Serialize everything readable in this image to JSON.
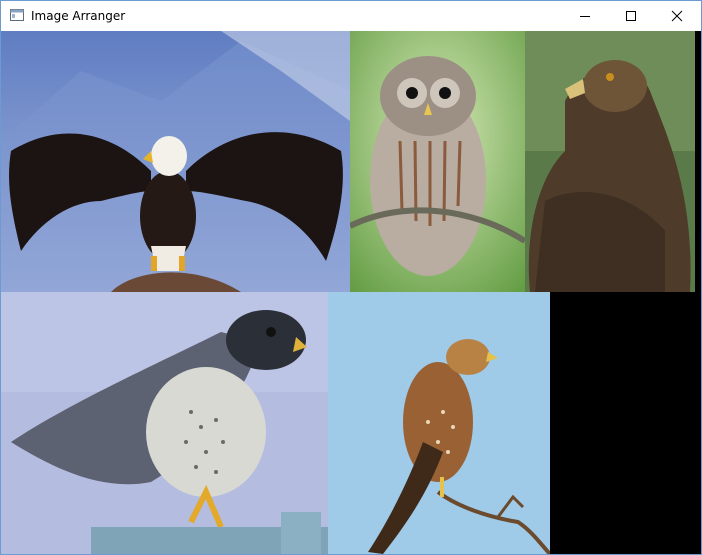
{
  "window": {
    "title": "Image Arranger",
    "controls": {
      "minimize": "minimize-icon",
      "maximize": "maximize-icon",
      "close": "close-icon"
    }
  },
  "images": [
    {
      "subject": "bald-eagle",
      "background": "#8aa2cc"
    },
    {
      "subject": "barred-owl",
      "background": "#8fbf6a"
    },
    {
      "subject": "golden-eagle",
      "background": "#5f7c4e"
    },
    {
      "subject": "peregrine-falcon",
      "background": "#b6bee0"
    },
    {
      "subject": "red-shouldered-hawk",
      "background": "#9dc8e6"
    }
  ],
  "colors": {
    "accent_border": "#6c9bd2",
    "empty_area": "#000000"
  }
}
